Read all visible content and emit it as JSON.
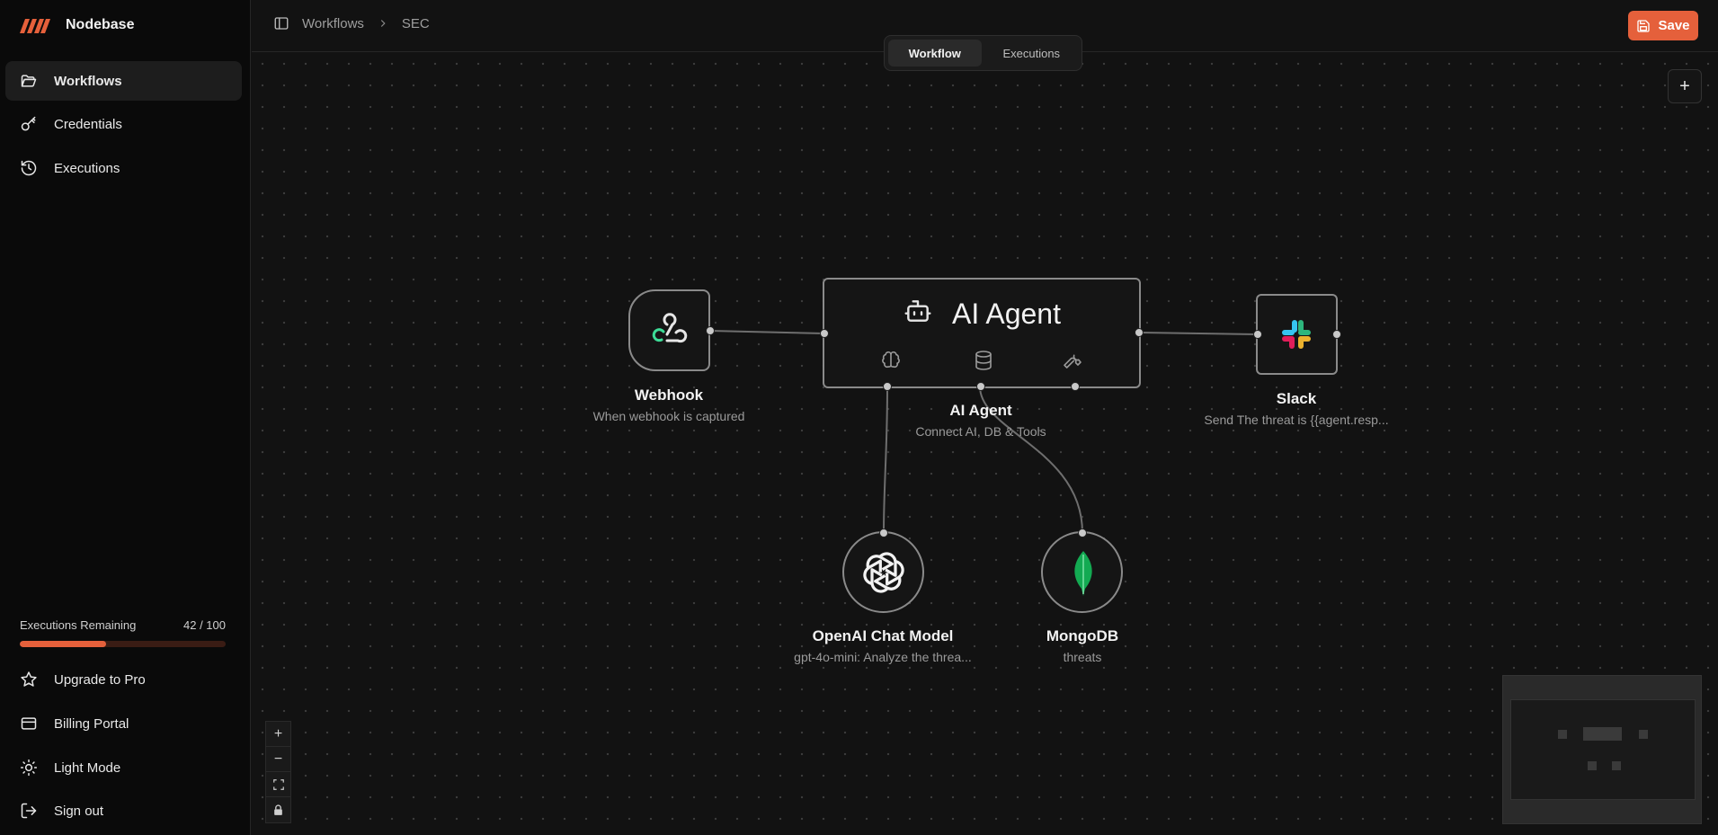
{
  "brand": {
    "name": "Nodebase",
    "accent": "#e5603b"
  },
  "sidebar": {
    "items": [
      {
        "label": "Workflows",
        "icon": "folder-open-icon",
        "active": true
      },
      {
        "label": "Credentials",
        "icon": "key-icon",
        "active": false
      },
      {
        "label": "Executions",
        "icon": "history-icon",
        "active": false
      }
    ],
    "executions": {
      "label": "Executions Remaining",
      "count": "42 / 100",
      "used_fraction": 0.42
    },
    "footer": [
      {
        "label": "Upgrade to Pro",
        "icon": "star-icon"
      },
      {
        "label": "Billing Portal",
        "icon": "credit-card-icon"
      },
      {
        "label": "Light Mode",
        "icon": "sun-icon"
      },
      {
        "label": "Sign out",
        "icon": "log-out-icon"
      }
    ]
  },
  "header": {
    "breadcrumb": [
      "Workflows",
      "SEC"
    ],
    "save_label": "Save",
    "tabs": [
      {
        "label": "Workflow",
        "active": true
      },
      {
        "label": "Executions",
        "active": false
      }
    ]
  },
  "nodes": {
    "webhook": {
      "title": "Webhook",
      "subtitle": "When webhook is captured",
      "icon": "webhook-icon"
    },
    "agent": {
      "header": "AI Agent",
      "title": "AI Agent",
      "subtitle": "Connect AI, DB & Tools",
      "icon": "bot-icon",
      "slots": [
        "brain-icon",
        "database-icon",
        "wrench-icon"
      ]
    },
    "slack": {
      "title": "Slack",
      "subtitle": "Send The threat is {{agent.resp...",
      "icon": "slack-icon"
    },
    "openai": {
      "title": "OpenAI Chat Model",
      "subtitle": "gpt-4o-mini: Analyze the threa...",
      "icon": "openai-icon"
    },
    "mongodb": {
      "title": "MongoDB",
      "subtitle": "threats",
      "icon": "mongodb-leaf-icon"
    }
  },
  "canvas_controls": {
    "zoom_in": "+",
    "zoom_out": "−"
  }
}
